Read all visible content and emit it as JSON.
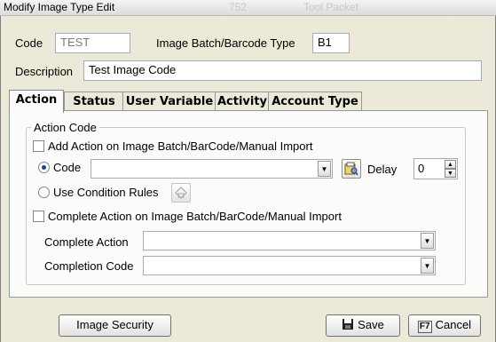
{
  "window": {
    "title": "Modify Image Type Edit",
    "ghost_text_1": "752",
    "ghost_text_2": "Tool Packet"
  },
  "form": {
    "code_label": "Code",
    "code_value": "TEST",
    "barcode_type_label": "Image Batch/Barcode Type",
    "barcode_type_value": "B1",
    "description_label": "Description",
    "description_value": "Test Image Code"
  },
  "tabs": [
    {
      "label": "Action",
      "active": true
    },
    {
      "label": "Status",
      "active": false
    },
    {
      "label": "User Variable",
      "active": false
    },
    {
      "label": "Activity",
      "active": false
    },
    {
      "label": "Account Type",
      "active": false
    }
  ],
  "action_panel": {
    "group_title": "Action Code",
    "add_action_label": "Add Action on Image Batch/BarCode/Manual Import",
    "add_action_checked": false,
    "code_radio_label": "Code",
    "code_radio_selected": true,
    "code_combo_value": "",
    "delay_label": "Delay",
    "delay_value": "0",
    "use_condition_label": "Use Condition Rules",
    "use_condition_selected": false,
    "complete_action_chk_label": "Complete Action on Image Batch/BarCode/Manual Import",
    "complete_action_checked": false,
    "complete_action_label": "Complete Action",
    "complete_action_value": "",
    "completion_code_label": "Completion Code",
    "completion_code_value": ""
  },
  "footer": {
    "image_security_label": "Image Security",
    "save_label": "Save",
    "save_icon": "floppy-disk-icon",
    "cancel_label": "Cancel",
    "cancel_icon": "f7-key-icon",
    "cancel_key": "F7"
  },
  "colors": {
    "window_bg": "#ece9d8",
    "panel_bg": "#fbfbf9",
    "radio_dot": "#1c3f94"
  }
}
